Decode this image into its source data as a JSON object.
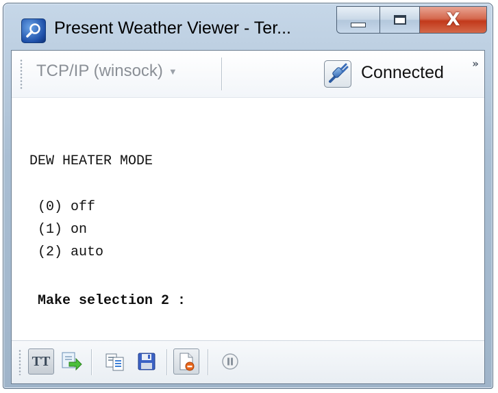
{
  "window": {
    "title": "Present Weather Viewer - Ter...",
    "icon": "magnifier-app-icon",
    "controls": {
      "minimize": "minimize-icon",
      "maximize": "maximize-icon",
      "close_glyph": "X"
    }
  },
  "toolbar_top": {
    "connection_type": "TCP/IP (winsock)",
    "connection_status": "Connected",
    "status_icon": "plug-connected-icon",
    "overflow_glyph": "»"
  },
  "terminal": {
    "lines": {
      "heading": "DEW HEATER MODE",
      "opt0": " (0) off",
      "opt1": " (1) on",
      "opt2": " (2) auto",
      "prompt": " Make selection 2 :"
    }
  },
  "toolbar_bottom": {
    "tt_label": "TT",
    "buttons": [
      "tt-font-icon",
      "send-file-icon",
      "copy-icon",
      "save-icon",
      "log-stop-icon",
      "pause-icon"
    ]
  },
  "colors": {
    "title_gradient": "#a9bed3",
    "close_red": "#c2391b",
    "terminal_text": "#111111"
  }
}
